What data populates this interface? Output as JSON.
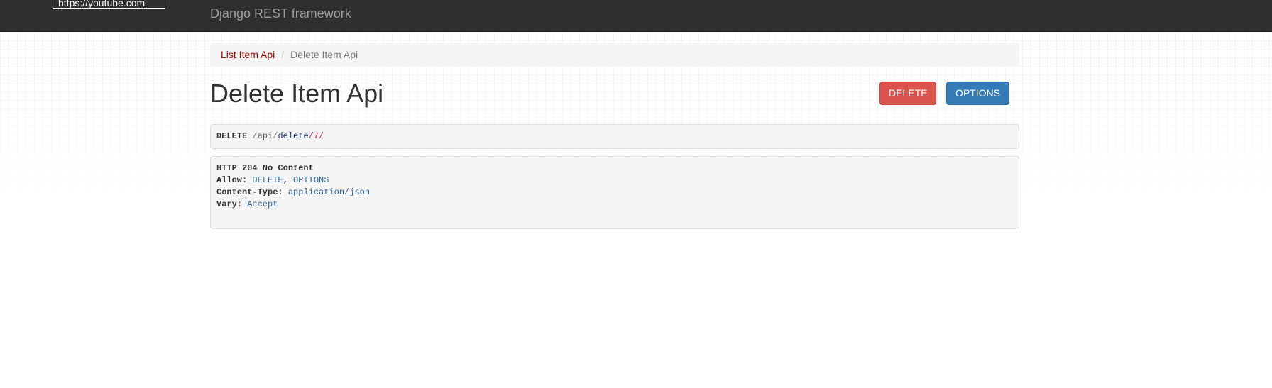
{
  "navbar": {
    "brand": "Django REST framework",
    "tooltip_url": "https://youtube.com"
  },
  "breadcrumb": {
    "items": [
      {
        "label": "List Item Api"
      },
      {
        "label": "Delete Item Api"
      }
    ],
    "separator": "/"
  },
  "content": {
    "title": "Delete Item Api",
    "buttons": {
      "delete_label": "DELETE",
      "options_label": "OPTIONS"
    }
  },
  "request": {
    "method": "DELETE",
    "path_segments": {
      "slash1": "/",
      "api": "api",
      "slash2": "/",
      "delete": "delete",
      "id_part": "/7/"
    }
  },
  "response": {
    "status": "HTTP 204 No Content",
    "headers": [
      {
        "name": "Allow:",
        "value": "DELETE, OPTIONS"
      },
      {
        "name": "Content-Type:",
        "value": "application/json"
      },
      {
        "name": "Vary:",
        "value": "Accept"
      }
    ]
  },
  "colors": {
    "navbar_bg": "#2f2f2f",
    "link": "#a30000",
    "delete_btn": "#d9534f",
    "options_btn": "#337ab7"
  }
}
